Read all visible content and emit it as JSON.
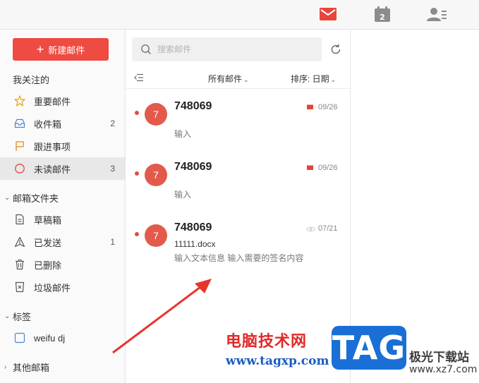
{
  "topbar": {
    "icons": [
      "mail-icon",
      "calendar-icon",
      "contacts-icon"
    ],
    "calendar_day": "2",
    "mail_icon_color": "#e8453c"
  },
  "sidebar": {
    "compose_label": "新建邮件",
    "compose_color": "#ee4b42",
    "favorites_title": "我关注的",
    "favorites": [
      {
        "label": "重要邮件",
        "count": "",
        "icon": "star-icon"
      },
      {
        "label": "收件箱",
        "count": "2",
        "icon": "inbox-icon"
      },
      {
        "label": "跟进事项",
        "count": "",
        "icon": "flag-icon"
      },
      {
        "label": "未读邮件",
        "count": "3",
        "icon": "unread-circle-icon"
      }
    ],
    "folders_title": "邮箱文件夹",
    "folders": [
      {
        "label": "草稿箱",
        "count": "",
        "icon": "draft-icon"
      },
      {
        "label": "已发送",
        "count": "1",
        "icon": "sent-icon"
      },
      {
        "label": "已删除",
        "count": "",
        "icon": "trash-icon"
      },
      {
        "label": "垃圾邮件",
        "count": "",
        "icon": "spam-icon"
      }
    ],
    "tags_title": "标签",
    "tags": [
      {
        "label": "weifu dj"
      }
    ],
    "other_title": "其他邮箱"
  },
  "list": {
    "search_placeholder": "搜索邮件",
    "filter_label": "所有邮件",
    "sort_label": "排序: 日期",
    "mails": [
      {
        "avatar": "7",
        "sender": "748069",
        "date": "09/26",
        "status_icon": "flag-icon",
        "subject": "",
        "preview": "输入",
        "unread": true
      },
      {
        "avatar": "7",
        "sender": "748069",
        "date": "09/26",
        "status_icon": "flag-icon",
        "subject": "",
        "preview": "输入",
        "unread": true
      },
      {
        "avatar": "7",
        "sender": "748069",
        "date": "07/21",
        "status_icon": "eye-icon",
        "subject": "11111.docx",
        "preview": "输入文本信息 输入需要的签名内容",
        "unread": true
      }
    ]
  },
  "watermark": {
    "line1": "电脑技术网",
    "line2": "www.tagxp.com",
    "badge": "TAG",
    "site1": "极光下载站",
    "site2": "www.xz7.com"
  }
}
